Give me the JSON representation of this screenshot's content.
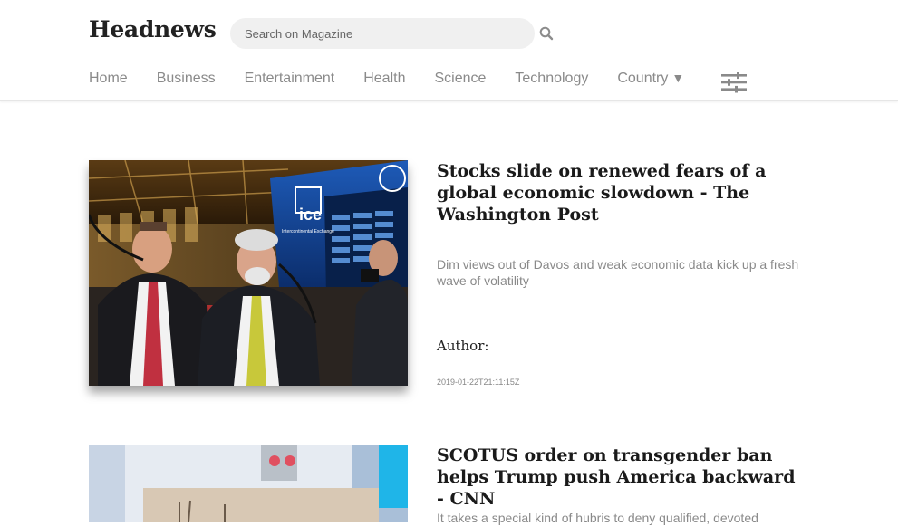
{
  "header": {
    "brand": "Headnews",
    "search": {
      "placeholder": "Search on Magazine",
      "value": ""
    },
    "search_icon": "search-icon",
    "filter_icon": "sliders-icon"
  },
  "nav": {
    "items": [
      {
        "label": "Home"
      },
      {
        "label": "Business"
      },
      {
        "label": "Entertainment"
      },
      {
        "label": "Health"
      },
      {
        "label": "Science"
      },
      {
        "label": "Technology"
      },
      {
        "label": "Country",
        "caret": "▼"
      }
    ]
  },
  "articles": [
    {
      "title": "Stocks slide on renewed fears of a global economic slowdown - The Washington Post",
      "description": "Dim views out of Davos and weak economic data kick up a fresh wave of volatility",
      "author_label": "Author:",
      "published": "2019-01-22T21:11:15Z",
      "image_text": "ice",
      "image_subtext": "Intercontinental Exchange"
    },
    {
      "title": "SCOTUS order on transgender ban helps Trump push America backward - CNN",
      "description": "It takes a special kind of hubris to deny qualified, devoted"
    }
  ],
  "colors": {
    "text_dark": "#1a1a1a",
    "nav_gray": "#8a8a8a",
    "search_bg": "#f0f0f0"
  }
}
